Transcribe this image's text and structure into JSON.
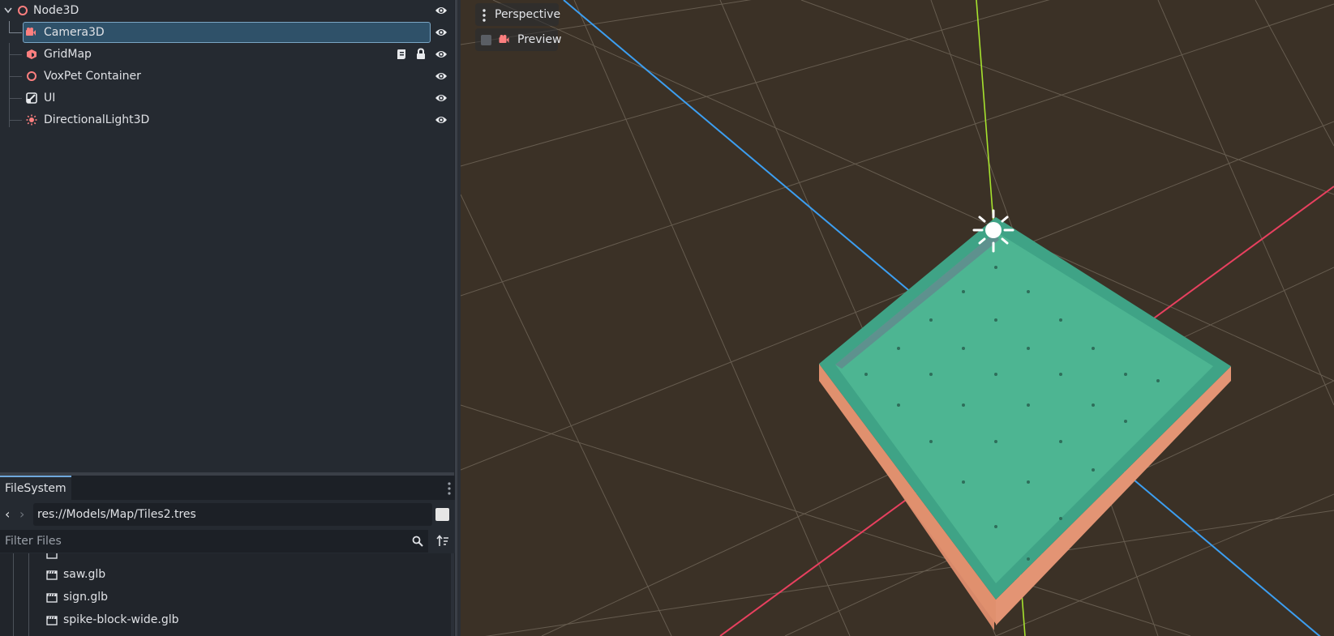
{
  "scene_tree": {
    "nodes": [
      {
        "name": "Node3D",
        "icon": "node3d-icon",
        "visible": true
      },
      {
        "name": "Camera3D",
        "icon": "camera-icon",
        "visible": true,
        "selected": true
      },
      {
        "name": "GridMap",
        "icon": "gridmap-icon",
        "visible": true,
        "has_script": true,
        "locked": true
      },
      {
        "name": "VoxPet Container",
        "icon": "node3d-icon",
        "visible": true
      },
      {
        "name": "UI",
        "icon": "control-icon",
        "visible": true
      },
      {
        "name": "DirectionalLight3D",
        "icon": "light-icon",
        "visible": true
      }
    ]
  },
  "filesystem": {
    "tab_label": "FileSystem",
    "path": "res://Models/Map/Tiles2.tres",
    "filter_placeholder": "Filter Files",
    "files": [
      "saw.glb",
      "sign.glb",
      "spike-block-wide.glb"
    ]
  },
  "viewport": {
    "perspective_label": "Perspective",
    "preview_label": "Preview",
    "preview_checked": false
  },
  "colors": {
    "accent": "#6fa8dc",
    "node_icon": "#fc7f7f",
    "viewport_bg": "#3b3126",
    "axis_x": "#e8405f",
    "axis_y": "#a6e22e",
    "axis_z": "#3c9ef0",
    "tile_green": "#4db592"
  }
}
